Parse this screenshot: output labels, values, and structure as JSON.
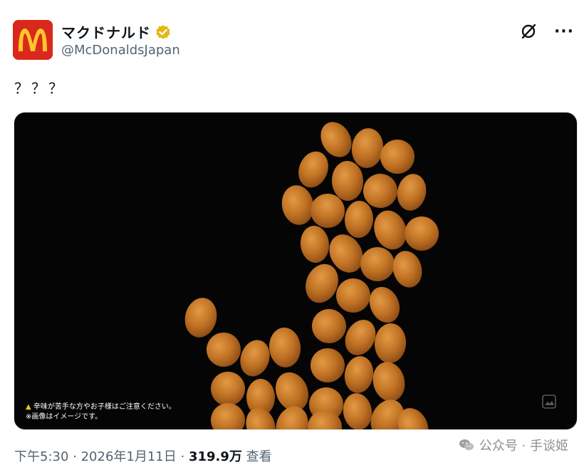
{
  "author": {
    "display_name": "マクドナルド",
    "handle": "@McDonaldsJapan",
    "avatar_icon": "mcdonalds-logo",
    "verified_icon": "verified-badge-icon"
  },
  "actions": {
    "grok_icon": "grok-icon",
    "more_icon": "more-icon",
    "more_label": "···"
  },
  "tweet": {
    "text": "？？？"
  },
  "media": {
    "caution_line1": "辛味が苦手な方やお子様はご注意ください。",
    "caution_line2": "※画像はイメージです。",
    "warning_symbol": "▲",
    "corner_icon": "media-expand-icon"
  },
  "meta": {
    "time": "下午5:30",
    "separator": " · ",
    "date": "2026年1月11日",
    "views_count": "319.9万",
    "views_label": "查看"
  },
  "watermark": {
    "icon": "wechat-icon",
    "text": "公众号 · 手谈姬"
  },
  "colors": {
    "brand_red": "#da291c",
    "brand_yellow": "#ffc72c",
    "verified_gold": "#e2b719",
    "nugget": "#b8691f"
  }
}
